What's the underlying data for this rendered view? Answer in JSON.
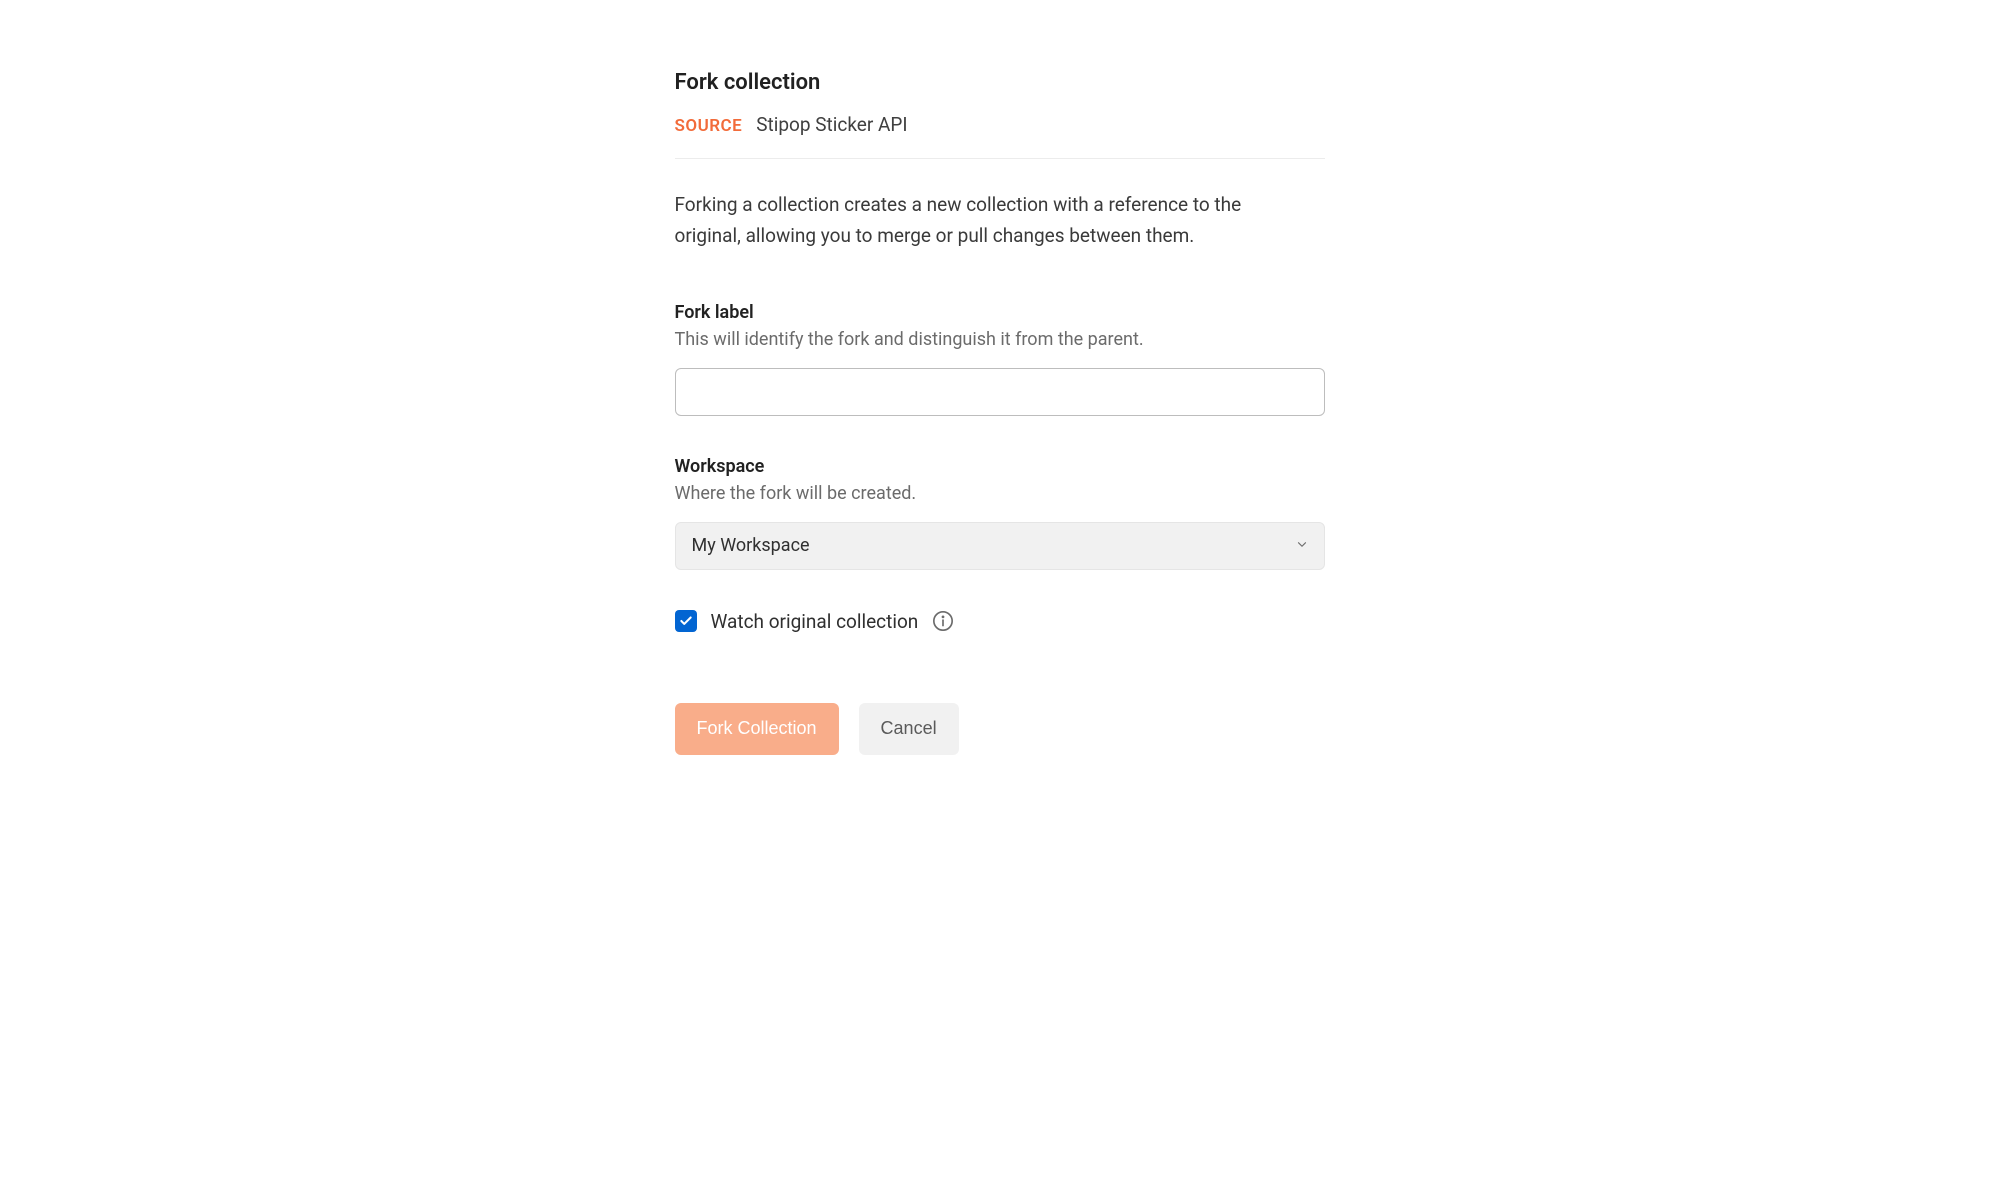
{
  "dialog": {
    "title": "Fork collection",
    "source_label": "SOURCE",
    "source_name": "Stipop Sticker API",
    "description": "Forking a collection creates a new collection with a reference to the original, allowing you to merge or pull changes between them.",
    "fork_label": {
      "label": "Fork label",
      "help": "This will identify the fork and distinguish it from the parent.",
      "value": ""
    },
    "workspace": {
      "label": "Workspace",
      "help": "Where the fork will be created.",
      "selected": "My Workspace"
    },
    "watch": {
      "label": "Watch original collection",
      "checked": true
    },
    "buttons": {
      "primary": "Fork Collection",
      "secondary": "Cancel"
    }
  }
}
